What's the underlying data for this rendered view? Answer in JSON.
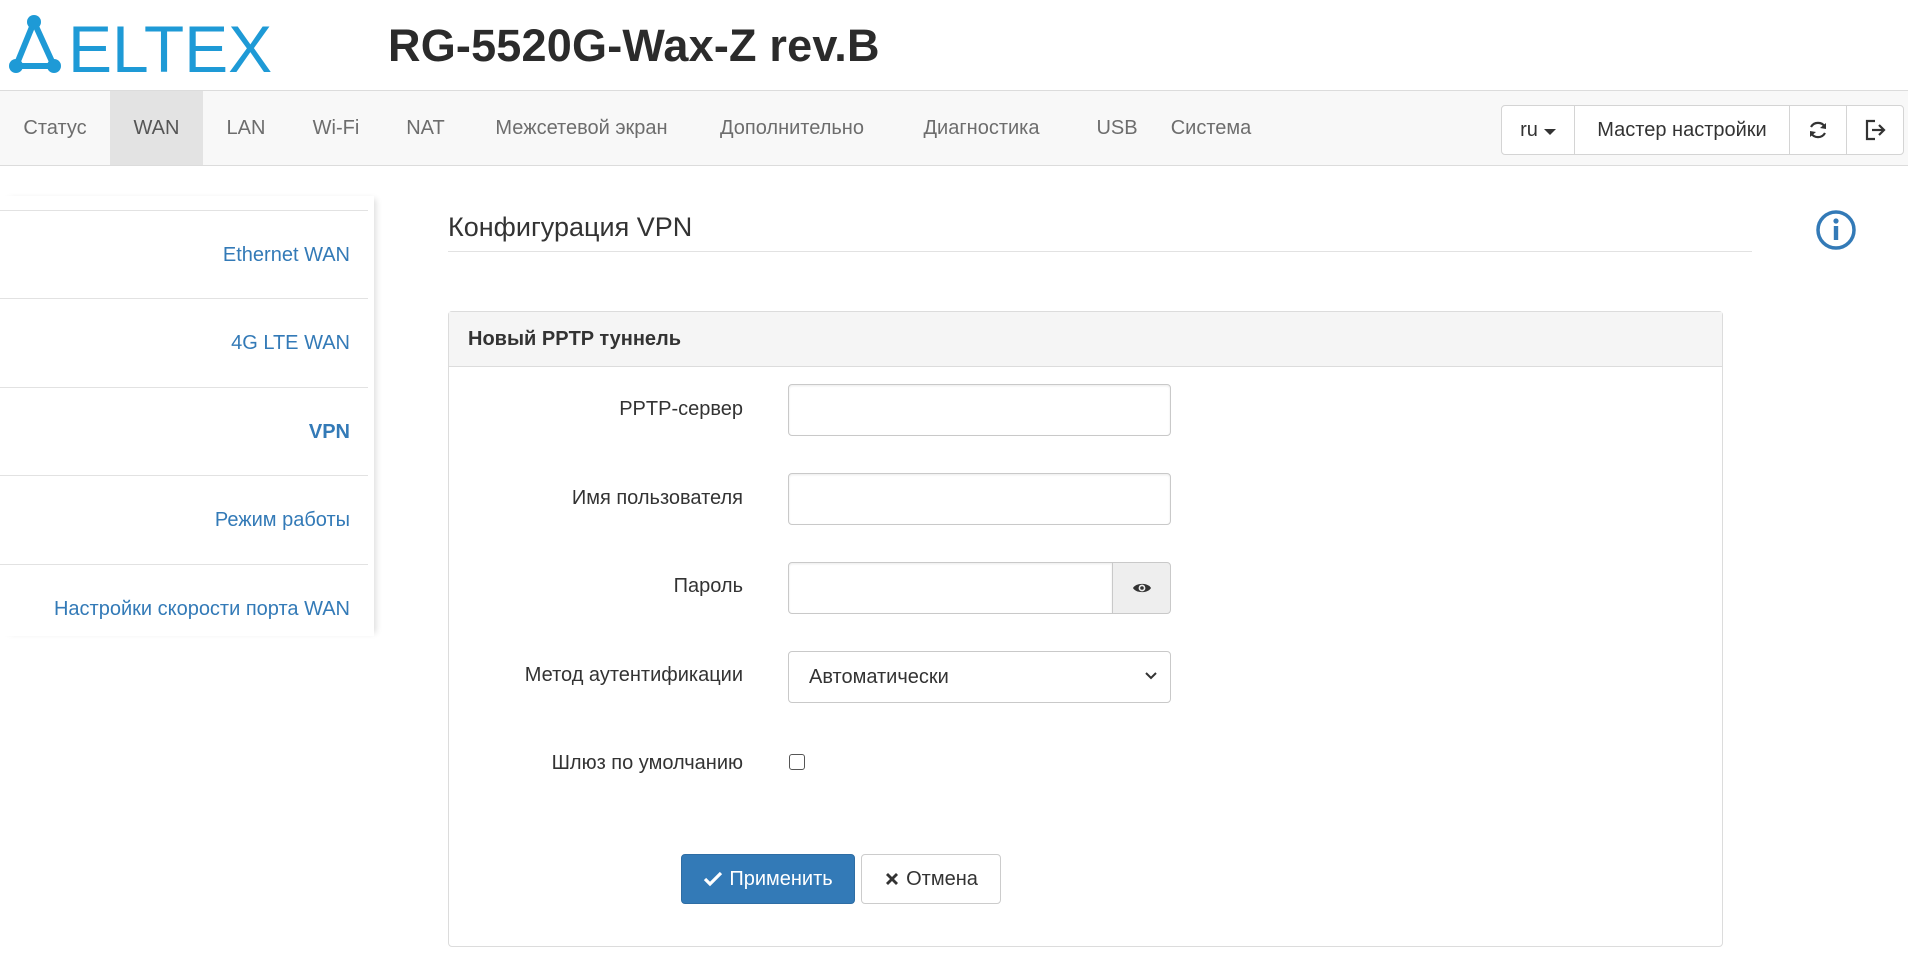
{
  "header": {
    "brand": "ELTEX",
    "model": "RG-5520G-Wax-Z rev.B",
    "brand_color": "#1e9ad6"
  },
  "nav": {
    "items": [
      {
        "label": "Статус"
      },
      {
        "label": "WAN",
        "active": true
      },
      {
        "label": "LAN"
      },
      {
        "label": "Wi-Fi"
      },
      {
        "label": "NAT"
      },
      {
        "label": "Межсетевой экран"
      },
      {
        "label": "Дополнительно"
      },
      {
        "label": "Диагностика"
      },
      {
        "label": "USB"
      },
      {
        "label": "Система"
      }
    ],
    "language": "ru",
    "wizard": "Мастер настройки",
    "refresh_icon": "refresh-icon",
    "logout_icon": "logout-icon"
  },
  "sidebar": {
    "items": [
      {
        "label": "Ethernet WAN"
      },
      {
        "label": "4G LTE WAN"
      },
      {
        "label": "VPN",
        "active": true
      },
      {
        "label": "Режим работы"
      },
      {
        "label": "Настройки скорости порта WAN"
      }
    ]
  },
  "page": {
    "title": "Конфигурация VPN",
    "info_icon": "info-icon"
  },
  "panel": {
    "heading": "Новый PPTP туннель",
    "fields": {
      "server": {
        "label": "PPTP-сервер",
        "value": ""
      },
      "username": {
        "label": "Имя пользователя",
        "value": ""
      },
      "password": {
        "label": "Пароль",
        "value": ""
      },
      "auth": {
        "label": "Метод аутентификации",
        "value": "Автоматически"
      },
      "gateway": {
        "label": "Шлюз по умолчанию",
        "checked": false
      }
    },
    "apply": "Применить",
    "cancel": "Отмена"
  },
  "colors": {
    "accent": "#337ab7",
    "nav_active_bg": "#e3e3e3",
    "link": "#337ab7"
  }
}
